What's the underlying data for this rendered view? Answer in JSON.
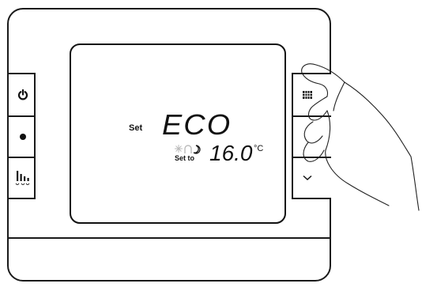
{
  "device": {
    "screen": {
      "set_label": "Set",
      "mode": "ECO",
      "set_to_label": "Set to",
      "setpoint": "16.0",
      "unit": "°C"
    },
    "left_buttons": [
      {
        "icon": "power-icon"
      },
      {
        "icon": "dot-icon"
      },
      {
        "icon": "schedule-bars-icon"
      }
    ],
    "right_buttons": [
      {
        "icon": "grid-menu-icon"
      },
      {
        "icon": "up-icon"
      },
      {
        "icon": "chevron-down-icon"
      }
    ]
  }
}
